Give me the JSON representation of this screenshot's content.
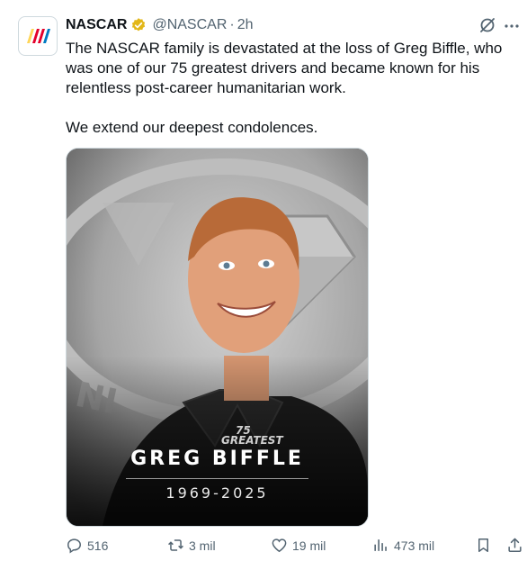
{
  "tweet": {
    "author_name": "NASCAR",
    "handle": "@NASCAR",
    "separator": "·",
    "time": "2h",
    "paragraphs": [
      "The NASCAR family is devastated at the loss of Greg Biffle, who was one of our 75 greatest drivers and became known for his relentless post-career humanitarian work.",
      "We extend our deepest condolences."
    ]
  },
  "media": {
    "overlay_name": "GREG BIFFLE",
    "overlay_years": "1969-2025",
    "badge_number": "75",
    "badge_text": "GREATEST"
  },
  "actions": {
    "replies": "516",
    "reposts": "3 mil",
    "likes": "19 mil",
    "views": "473 mil"
  },
  "colors": {
    "verified": "#e2b719",
    "icon_gray": "#536471",
    "text": "#0f1419",
    "logo_yellow": "#ffd659",
    "logo_red": "#e4002b",
    "logo_blue": "#007ac2"
  }
}
